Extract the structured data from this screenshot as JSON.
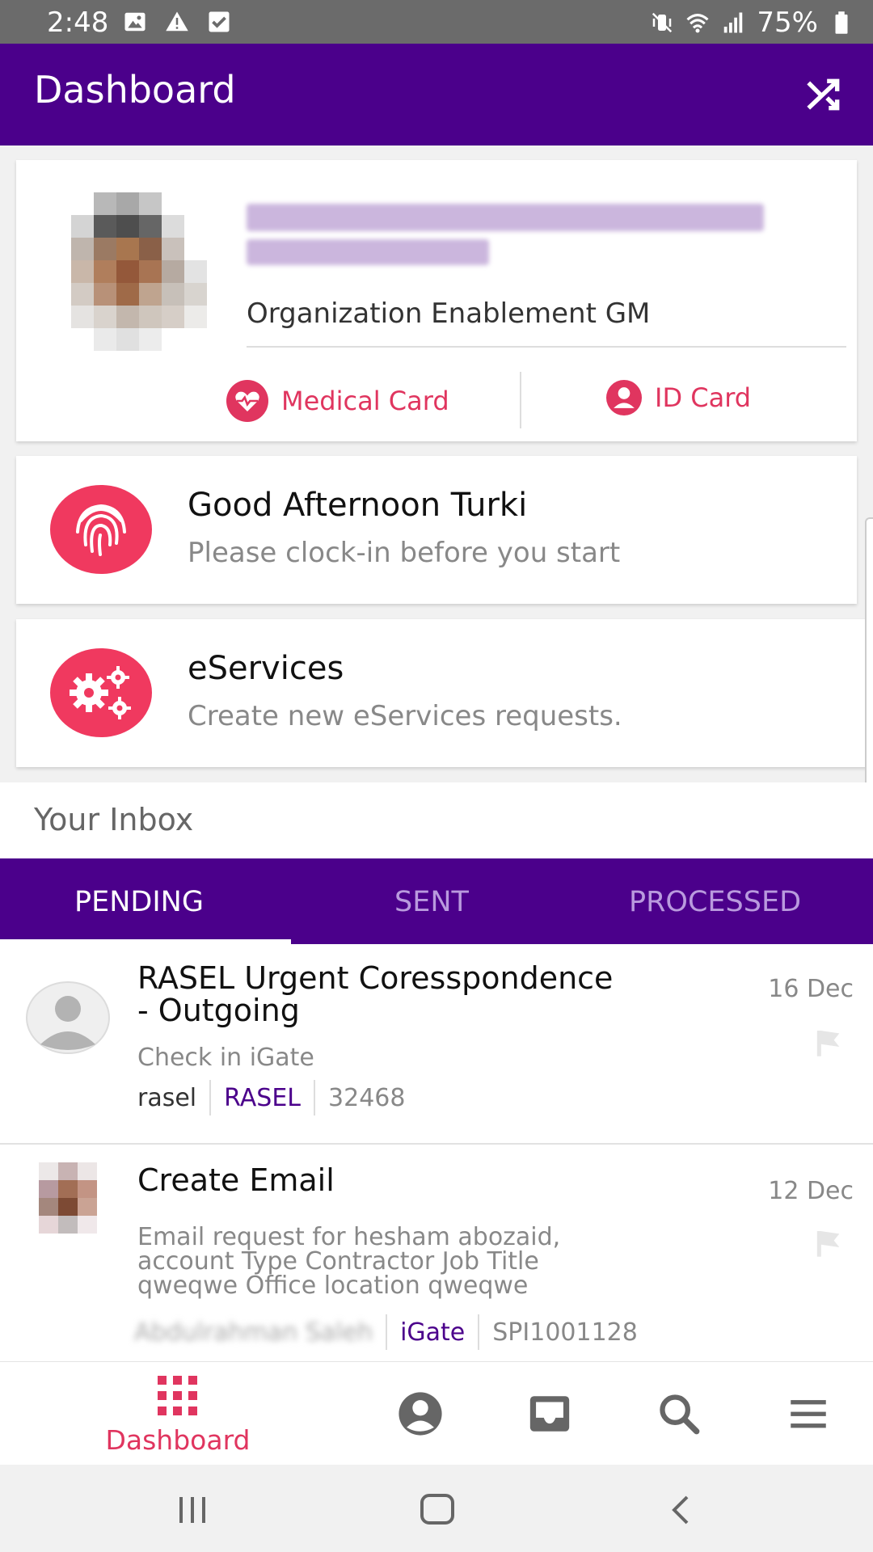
{
  "status_bar": {
    "time": "2:48",
    "battery": "75%",
    "left_icons": [
      "image-icon",
      "warning-icon",
      "check-box-icon"
    ],
    "right_icons": [
      "mute-icon",
      "wifi-icon",
      "signal-icon",
      "battery-icon"
    ]
  },
  "app_bar": {
    "title": "Dashboard",
    "action_icon": "shuffle-icon"
  },
  "profile": {
    "position": "Organization Enablement GM",
    "medical_card_label": "Medical Card",
    "id_card_label": "ID Card"
  },
  "greeting": {
    "title": "Good Afternoon Turki",
    "subtitle": "Please clock-in before you start"
  },
  "eservices": {
    "title": "eServices",
    "subtitle": "Create new eServices requests."
  },
  "inbox": {
    "title": "Your Inbox",
    "tabs": [
      {
        "label": "PENDING",
        "active": true
      },
      {
        "label": "SENT",
        "active": false
      },
      {
        "label": "PROCESSED",
        "active": false
      }
    ],
    "items": [
      {
        "title_line1": "RASEL Urgent Coresspondence",
        "title_line2": "- Outgoing",
        "subtitle": "Check in iGate",
        "from": "rasel",
        "system": "RASEL",
        "id": "32468",
        "date": "16 Dec"
      },
      {
        "title_line1": "Create Email",
        "subtitle_line1": "Email request for hesham abozaid,",
        "subtitle_line2": "account Type Contractor Job Title",
        "subtitle_line3": "qweqwe Office location qweqwe",
        "from": "Abdulrahman Saleh",
        "system": "iGate",
        "id": "SPI1001128",
        "date": "12 Dec"
      }
    ]
  },
  "bottom_nav": {
    "dashboard_label": "Dashboard",
    "icons": [
      "grid-icon",
      "account-icon",
      "inbox-icon",
      "search-icon",
      "menu-icon"
    ]
  },
  "colors": {
    "primary": "#4b008b",
    "accent": "#e0355f",
    "status_bar": "#6b6b6b"
  }
}
